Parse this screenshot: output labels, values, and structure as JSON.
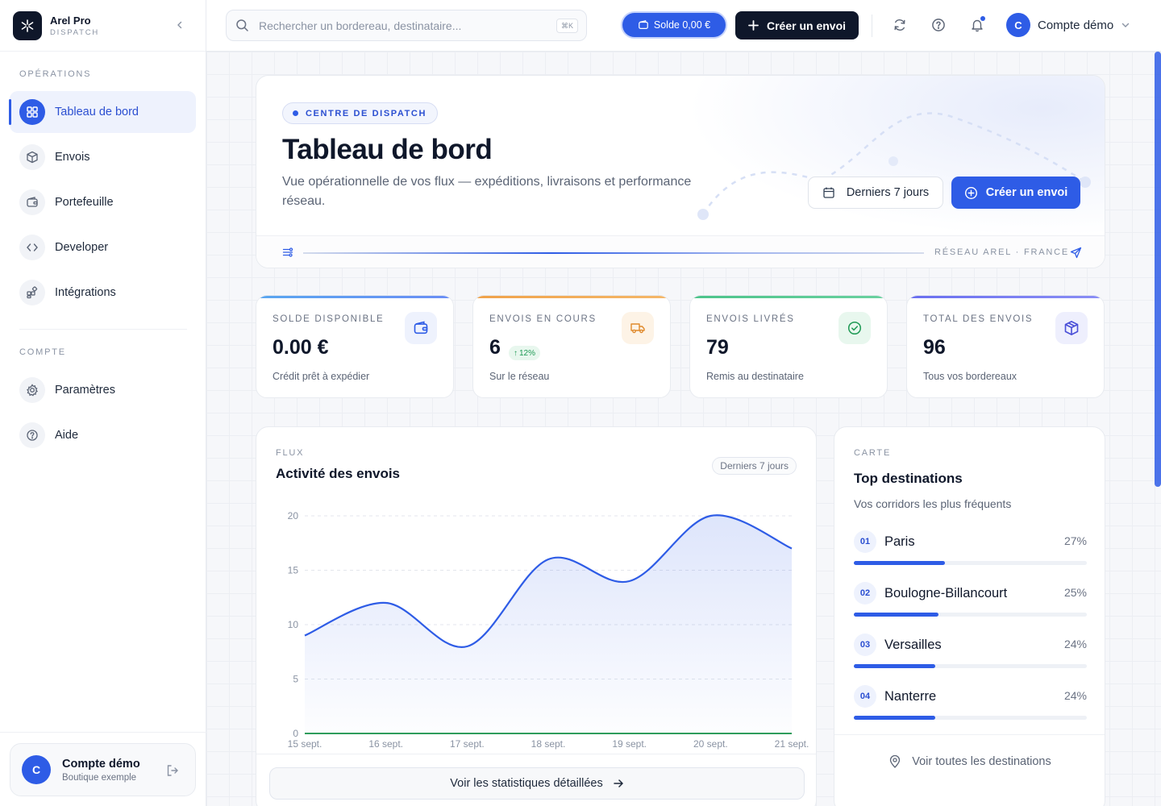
{
  "brand": {
    "name": "Arel Pro",
    "subtitle": "DISPATCH"
  },
  "sidebar": {
    "section_operations": "OPÉRATIONS",
    "section_account": "COMPTE",
    "items": [
      {
        "label": "Tableau de bord",
        "icon": "dashboard-icon",
        "active": true
      },
      {
        "label": "Envois",
        "icon": "box-icon"
      },
      {
        "label": "Portefeuille",
        "icon": "wallet-icon"
      },
      {
        "label": "Developer",
        "icon": "code-icon"
      },
      {
        "label": "Intégrations",
        "icon": "integrations-icon"
      }
    ],
    "account_items": [
      {
        "label": "Paramètres",
        "icon": "gear-icon"
      },
      {
        "label": "Aide",
        "icon": "help-icon"
      }
    ],
    "account": {
      "initial": "C",
      "name": "Compte démo",
      "sub": "Boutique exemple"
    }
  },
  "topbar": {
    "search_placeholder": "Rechercher un bordereau, destinataire...",
    "search_shortcut": "⌘K",
    "balance_label": "Solde 0,00 €",
    "create_label": "Créer un envoi",
    "account_initial": "C",
    "account_name": "Compte démo"
  },
  "hero": {
    "tag": "CENTRE DE DISPATCH",
    "title": "Tableau de bord",
    "subtitle": "Vue opérationnelle de vos flux — expéditions, livraisons et performance réseau.",
    "range_label": "Derniers 7 jours",
    "create_label": "Créer un envoi",
    "network_label": "RÉSEAU AREL · FRANCE"
  },
  "stats": [
    {
      "label": "SOLDE DISPONIBLE",
      "value": "0.00 €",
      "desc": "Crédit prêt à expédier",
      "icon": "wallet-icon",
      "color": "#5aa7f0"
    },
    {
      "label": "ENVOIS EN COURS",
      "value": "6",
      "trend": "12%",
      "desc": "Sur le réseau",
      "icon": "truck-icon",
      "color": "#f0a24a"
    },
    {
      "label": "ENVOIS LIVRÉS",
      "value": "79",
      "desc": "Remis au destinataire",
      "icon": "check-circle-icon",
      "color": "#4cc48a"
    },
    {
      "label": "TOTAL DES ENVOIS",
      "value": "96",
      "desc": "Tous vos bordereaux",
      "icon": "cube-icon",
      "color": "#6a6ff0"
    }
  ],
  "activity": {
    "kicker": "FLUX",
    "title": "Activité des envois",
    "range": "Derniers 7 jours",
    "footer_button": "Voir les statistiques détaillées"
  },
  "chart_data": {
    "type": "area",
    "title": "Activité des envois",
    "categories": [
      "15 sept.",
      "16 sept.",
      "17 sept.",
      "18 sept.",
      "19 sept.",
      "20 sept.",
      "21 sept."
    ],
    "series": [
      {
        "values": [
          9,
          12,
          8,
          16,
          14,
          20,
          17
        ],
        "color": "#2e5ce6"
      },
      {
        "values": [
          0,
          0,
          0,
          0,
          0,
          0,
          0
        ],
        "color": "#2f9d5c"
      }
    ],
    "yticks": [
      0,
      5,
      10,
      15,
      20
    ],
    "ylim": [
      0,
      20
    ],
    "grid": true
  },
  "destinations": {
    "kicker": "CARTE",
    "title": "Top destinations",
    "subtitle": "Vos corridors les plus fréquents",
    "items": [
      {
        "rank": "01",
        "name": "Paris",
        "pct_label": "27%",
        "pct": 27
      },
      {
        "rank": "02",
        "name": "Boulogne-Billancourt",
        "pct_label": "25%",
        "pct": 25
      },
      {
        "rank": "03",
        "name": "Versailles",
        "pct_label": "24%",
        "pct": 24
      },
      {
        "rank": "04",
        "name": "Nanterre",
        "pct_label": "24%",
        "pct": 24
      }
    ],
    "footer_link": "Voir toutes les destinations"
  }
}
